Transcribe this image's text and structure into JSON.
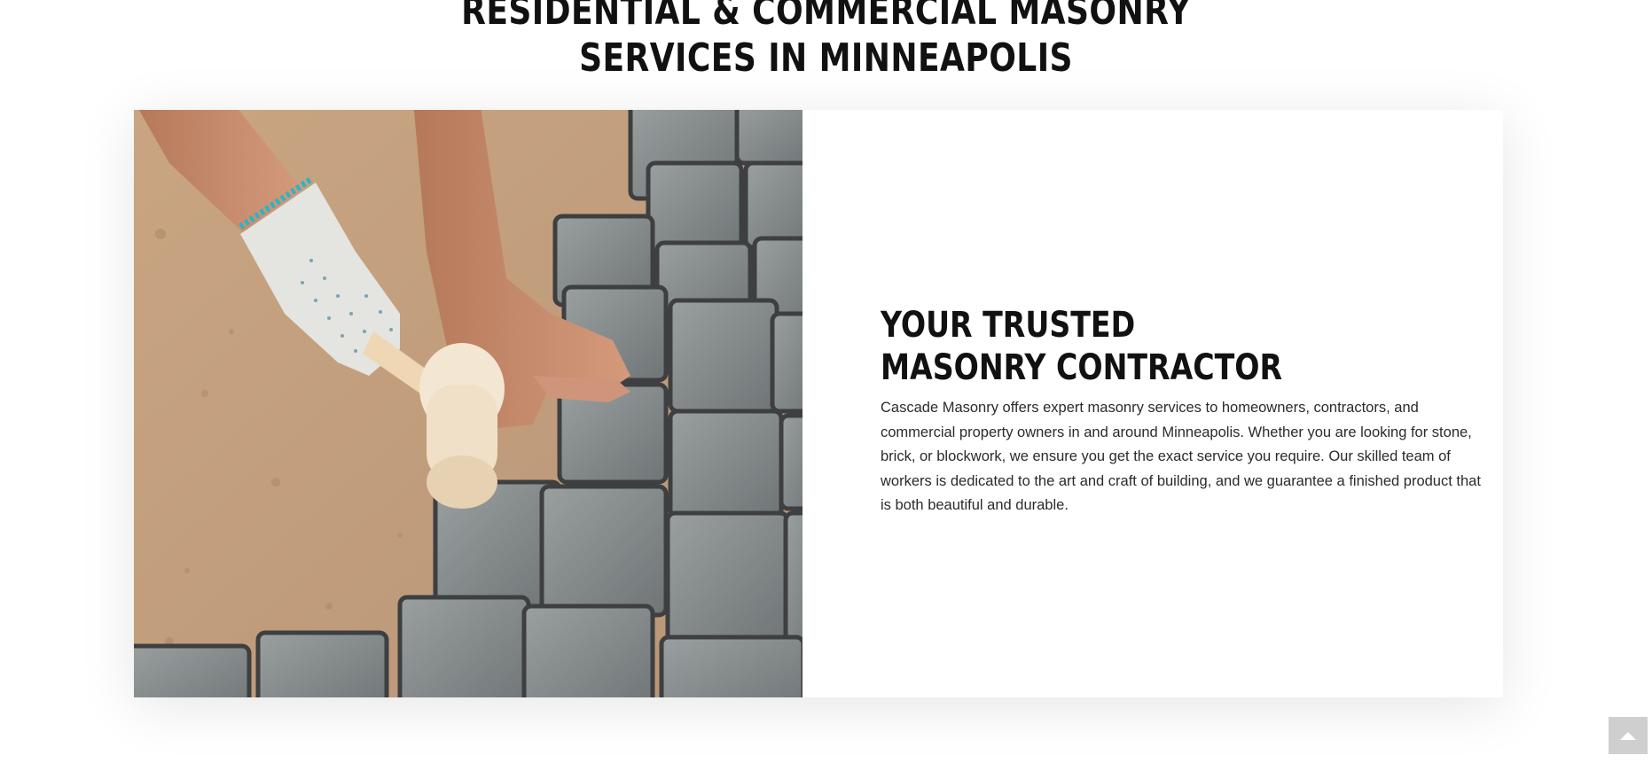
{
  "section": {
    "heading_line1": "RESIDENTIAL & COMMERCIAL MASONRY",
    "heading_line2": "SERVICES IN MINNEAPOLIS"
  },
  "feature": {
    "title_line1": "YOUR TRUSTED",
    "title_line2": "MASONRY CONTRACTOR",
    "body": "Cascade Masonry offers expert masonry services to homeowners, contractors, and commercial property owners in and around Minneapolis. Whether you are looking for stone, brick, or blockwork, we ensure you get the exact service you require. Our skilled team of workers is dedicated to the art and craft of building, and we guarantee a finished product that is both beautiful and durable.",
    "photo_icon": "masonry-worker-photo"
  },
  "scroll_top": {
    "icon": "chevron-up-icon"
  },
  "colors": {
    "heading": "#111111",
    "body_text": "#2b2b2b",
    "sand": "#c4a17e",
    "stone": "#8a8f90",
    "scroll_button": "#cfcfcf"
  }
}
